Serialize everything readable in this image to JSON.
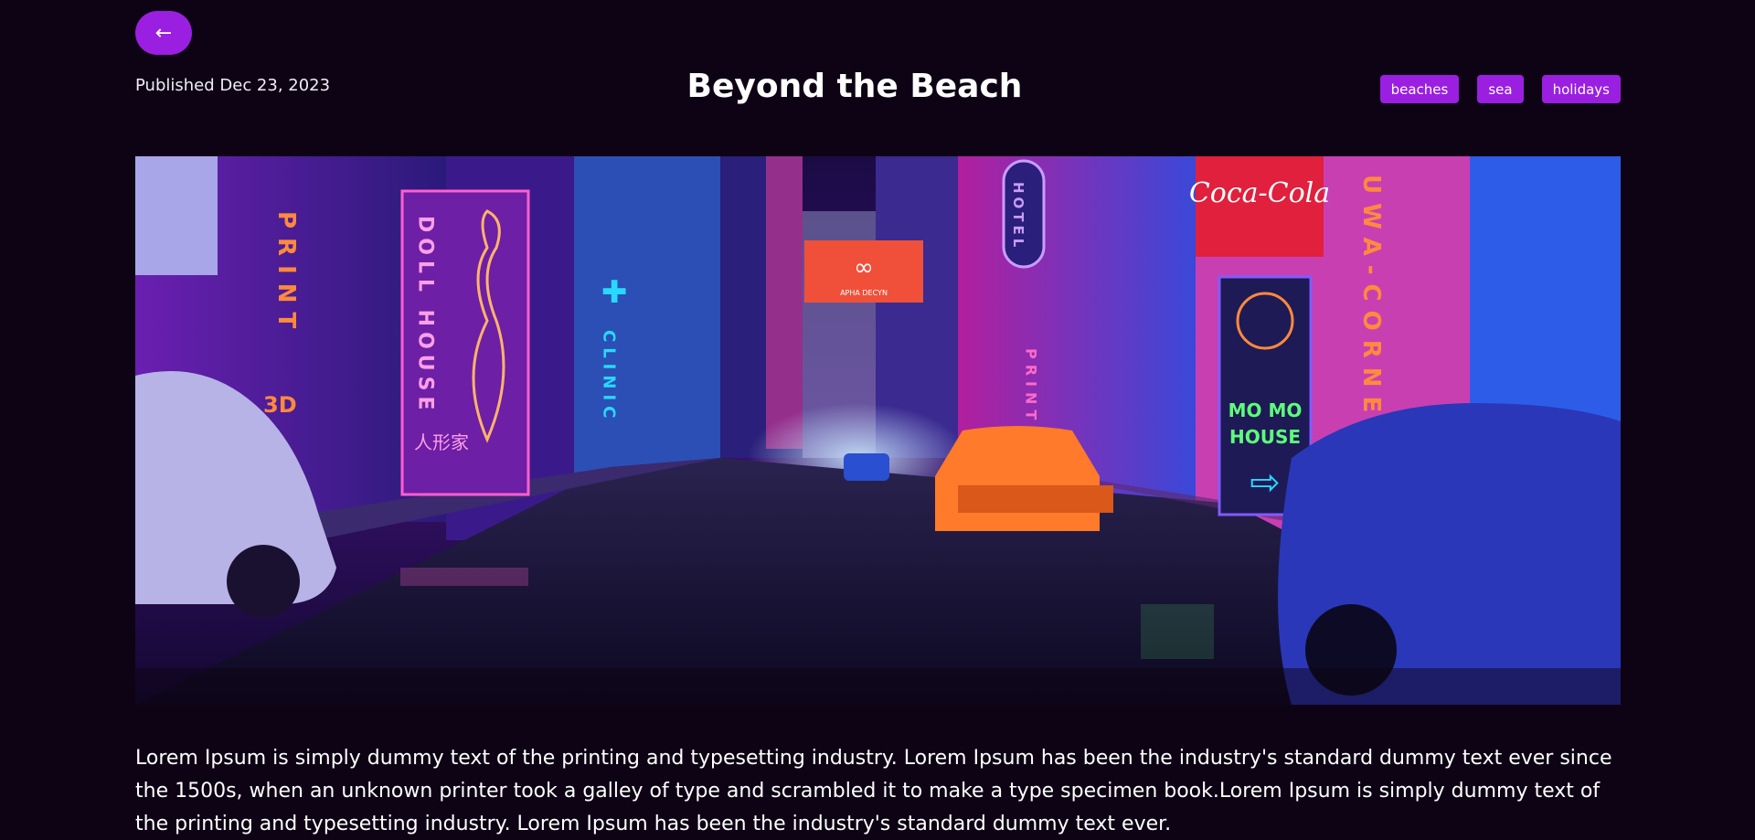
{
  "header": {
    "back_icon": "arrow-left-icon",
    "back_glyph": "←",
    "published": "Published Dec 23, 2023",
    "title": "Beyond the Beach",
    "tags": [
      "beaches",
      "sea",
      "holidays"
    ]
  },
  "hero": {
    "signs": {
      "print": "PRINT",
      "print_3d": "3D",
      "doll_house": "DOLL HOUSE",
      "doll_house_cjk": "人形家",
      "clinic": "CLINIC",
      "hotel": "HOTEL",
      "cola": "Coca-Cola",
      "mo_mo": "MO MO",
      "house": "HOUSE",
      "corner": "UWA-CORNE",
      "billboard": "APHA DECYN",
      "print_small": "PRINT"
    },
    "colors": {
      "accent": "#9b1fe0",
      "neon_pink": "#ff3fa4",
      "neon_cyan": "#28d9ff",
      "neon_orange": "#ff8a3d",
      "neon_green": "#5dff7a"
    }
  },
  "article": {
    "body": "Lorem Ipsum is simply dummy text of the printing and typesetting industry. Lorem Ipsum has been the industry's standard dummy text ever since the 1500s, when an unknown printer took a galley of type and scrambled it to make a type specimen book.Lorem Ipsum is simply dummy text of the printing and typesetting industry. Lorem Ipsum has been the industry's standard dummy text ever."
  }
}
